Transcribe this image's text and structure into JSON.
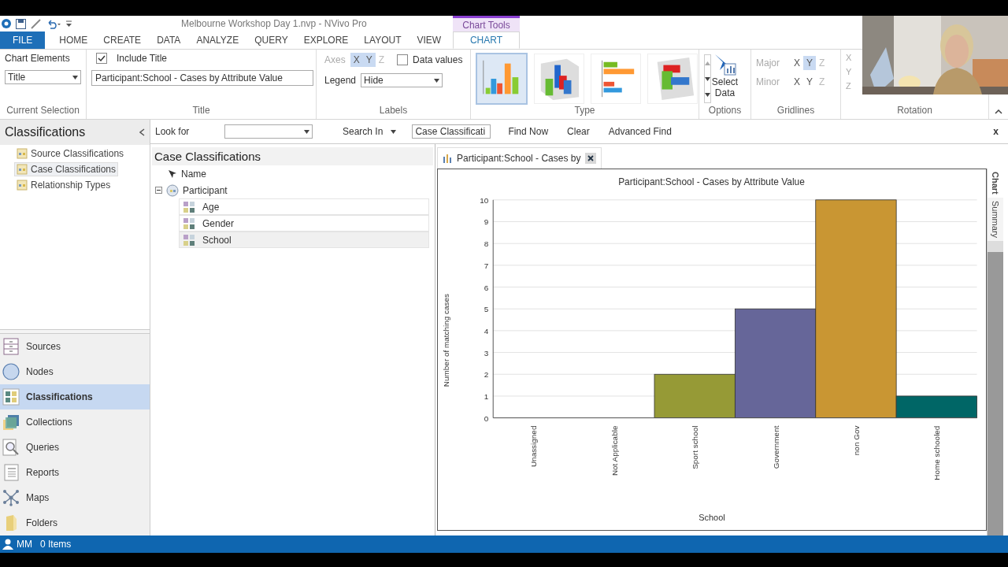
{
  "app_window": {
    "title": "Melbourne Workshop Day 1.nvp - NVivo Pro",
    "contextual_group": "Chart Tools"
  },
  "ribbon_tabs": [
    {
      "label": "FILE",
      "kind": "file",
      "selected": false
    },
    {
      "label": "HOME",
      "kind": "tab",
      "selected": false
    },
    {
      "label": "CREATE",
      "kind": "tab",
      "selected": false
    },
    {
      "label": "DATA",
      "kind": "tab",
      "selected": false
    },
    {
      "label": "ANALYZE",
      "kind": "tab",
      "selected": false
    },
    {
      "label": "QUERY",
      "kind": "tab",
      "selected": false
    },
    {
      "label": "EXPLORE",
      "kind": "tab",
      "selected": false
    },
    {
      "label": "LAYOUT",
      "kind": "tab",
      "selected": false
    },
    {
      "label": "VIEW",
      "kind": "tab",
      "selected": false
    },
    {
      "label": "CHART",
      "kind": "contextual",
      "selected": true
    }
  ],
  "ribbon": {
    "current_selection": {
      "label": "Chart Elements",
      "value": "Title",
      "group": "Current Selection"
    },
    "title_group": {
      "include_title": {
        "label": "Include Title",
        "checked": true
      },
      "title_value": "Participant:School - Cases by Attribute Value",
      "group": "Title"
    },
    "labels_group": {
      "axes_label": "Axes",
      "axes": [
        {
          "label": "X",
          "selected": true,
          "disabled": false
        },
        {
          "label": "Y",
          "selected": true,
          "disabled": false
        },
        {
          "label": "Z",
          "selected": false,
          "disabled": true
        }
      ],
      "data_values": {
        "label": "Data values",
        "checked": false
      },
      "legend_label": "Legend",
      "legend_value": "Hide",
      "group": "Labels"
    },
    "type_group": {
      "chart_types": [
        {
          "kind": "column",
          "selected": true
        },
        {
          "kind": "column3d",
          "selected": false
        },
        {
          "kind": "bar",
          "selected": false
        },
        {
          "kind": "bar3d",
          "selected": false
        }
      ],
      "group": "Type"
    },
    "options_group": {
      "button": "Select Data",
      "group": "Options"
    },
    "gridlines_group": {
      "major_label": "Major",
      "major": [
        {
          "label": "X",
          "selected": false,
          "disabled": false
        },
        {
          "label": "Y",
          "selected": true,
          "disabled": false
        },
        {
          "label": "Z",
          "selected": false,
          "disabled": true
        }
      ],
      "minor_label": "Minor",
      "minor": [
        {
          "label": "X",
          "selected": false,
          "disabled": false
        },
        {
          "label": "Y",
          "selected": false,
          "disabled": false
        },
        {
          "label": "Z",
          "selected": false,
          "disabled": true
        }
      ],
      "group": "Gridlines"
    },
    "rotation_group": {
      "axes": [
        "X",
        "Y",
        "Z"
      ],
      "group": "Rotation"
    }
  },
  "navigation": {
    "title": "Classifications",
    "items": [
      {
        "label": "Source Classifications",
        "selected": false
      },
      {
        "label": "Case Classifications",
        "selected": true
      },
      {
        "label": "Relationship Types",
        "selected": false
      }
    ]
  },
  "nav_buttons": [
    {
      "label": "Sources",
      "kind": "sources",
      "selected": false
    },
    {
      "label": "Nodes",
      "kind": "nodes",
      "selected": false
    },
    {
      "label": "Classifications",
      "kind": "classifications",
      "selected": true
    },
    {
      "label": "Collections",
      "kind": "collections",
      "selected": false
    },
    {
      "label": "Queries",
      "kind": "queries",
      "selected": false
    },
    {
      "label": "Reports",
      "kind": "reports",
      "selected": false
    },
    {
      "label": "Maps",
      "kind": "maps",
      "selected": false
    },
    {
      "label": "Folders",
      "kind": "folders",
      "selected": false
    }
  ],
  "find_bar": {
    "look_for": "Look for",
    "search_in": "Search In",
    "search_in_value": "Case Classificati",
    "find_now": "Find Now",
    "clear": "Clear",
    "advanced_find": "Advanced Find",
    "close": "x"
  },
  "list_view": {
    "title": "Case Classifications",
    "column": "Name",
    "tree": [
      {
        "label": "Participant",
        "expanded": true,
        "children": [
          {
            "label": "Age",
            "selected": false
          },
          {
            "label": "Gender",
            "selected": false
          },
          {
            "label": "School",
            "selected": true
          }
        ]
      }
    ]
  },
  "chart_view": {
    "tab": "Participant:School - Cases by",
    "side_tabs": [
      {
        "label": "Chart",
        "selected": true
      },
      {
        "label": "Summary",
        "selected": false
      }
    ],
    "bar_colors": [
      {
        "color": "#969a36"
      },
      {
        "color": "#666699"
      },
      {
        "color": "#c99633"
      },
      {
        "color": "#006666"
      }
    ],
    "chart_data": {
      "type": "bar",
      "title": "Participant:School - Cases by Attribute Value",
      "xlabel": "School",
      "ylabel": "Number of matching cases",
      "categories": [
        "Unassigned",
        "Not Applicable",
        "Sport school",
        "Government",
        "non Gov",
        "Home schooled"
      ],
      "values": [
        0,
        0,
        2,
        5,
        10,
        1
      ],
      "grid": true,
      "ylim": [
        0,
        10
      ],
      "yticks": [
        0,
        1,
        2,
        3,
        4,
        5,
        6,
        7,
        8,
        9,
        10
      ]
    }
  },
  "status_bar": {
    "user": "MM",
    "items": "0 Items"
  }
}
